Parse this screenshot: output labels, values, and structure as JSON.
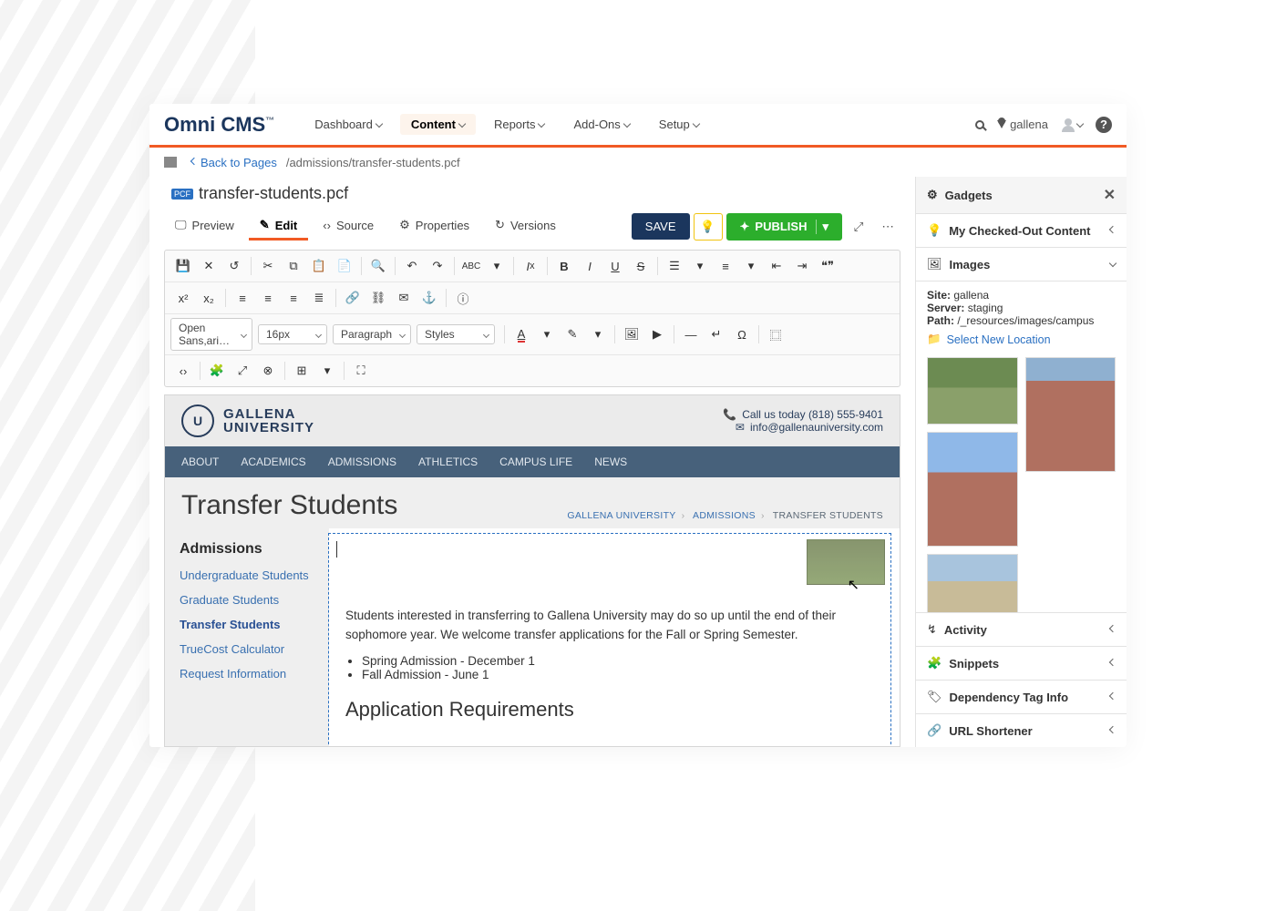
{
  "brand": "Omni CMS",
  "nav": [
    {
      "label": "Dashboard",
      "active": false
    },
    {
      "label": "Content",
      "active": true
    },
    {
      "label": "Reports",
      "active": false
    },
    {
      "label": "Add-Ons",
      "active": false
    },
    {
      "label": "Setup",
      "active": false
    }
  ],
  "site_name": "gallena",
  "breadcrumb": {
    "back": "Back to Pages",
    "path": "/admissions/transfer-students.pcf"
  },
  "file_title": "transfer-students.pcf",
  "file_tabs": {
    "preview": "Preview",
    "edit": "Edit",
    "source": "Source",
    "properties": "Properties",
    "versions": "Versions"
  },
  "actions": {
    "save": "SAVE",
    "publish": "PUBLISH"
  },
  "ribbon": {
    "font": "Open Sans,ari…",
    "size": "16px",
    "block": "Paragraph",
    "styles": "Styles"
  },
  "site": {
    "name_top": "GALLENA",
    "name_bot": "UNIVERSITY",
    "phone_label": "Call us today (818) 555-9401",
    "email": "info@gallenauniversity.com",
    "nav": [
      "ABOUT",
      "ACADEMICS",
      "ADMISSIONS",
      "ATHLETICS",
      "CAMPUS LIFE",
      "NEWS"
    ],
    "page_title": "Transfer Students",
    "crumbs": [
      "GALLENA UNIVERSITY",
      "ADMISSIONS",
      "TRANSFER STUDENTS"
    ]
  },
  "left_nav": {
    "heading": "Admissions",
    "items": [
      {
        "label": "Undergraduate Students",
        "current": false
      },
      {
        "label": "Graduate Students",
        "current": false
      },
      {
        "label": "Transfer Students",
        "current": true
      },
      {
        "label": "TrueCost Calculator",
        "current": false
      },
      {
        "label": "Request Information",
        "current": false
      }
    ]
  },
  "content": {
    "para": "Students interested in transferring to Gallena University may do so up until the end of their sophomore year. We welcome transfer applications for the Fall or Spring Semester.",
    "bullets": [
      "Spring Admission - December 1",
      "Fall Admission - June 1"
    ],
    "h3": "Application Requirements"
  },
  "gadgets": {
    "title": "Gadgets",
    "checked_out": "My Checked-Out Content",
    "images": "Images",
    "site_label": "Site:",
    "site_val": "gallena",
    "server_label": "Server:",
    "server_val": "staging",
    "path_label": "Path:",
    "path_val": "/_resources/images/campus",
    "new_loc": "Select New Location",
    "activity": "Activity",
    "snippets": "Snippets",
    "dep": "Dependency Tag Info",
    "shortener": "URL Shortener"
  }
}
